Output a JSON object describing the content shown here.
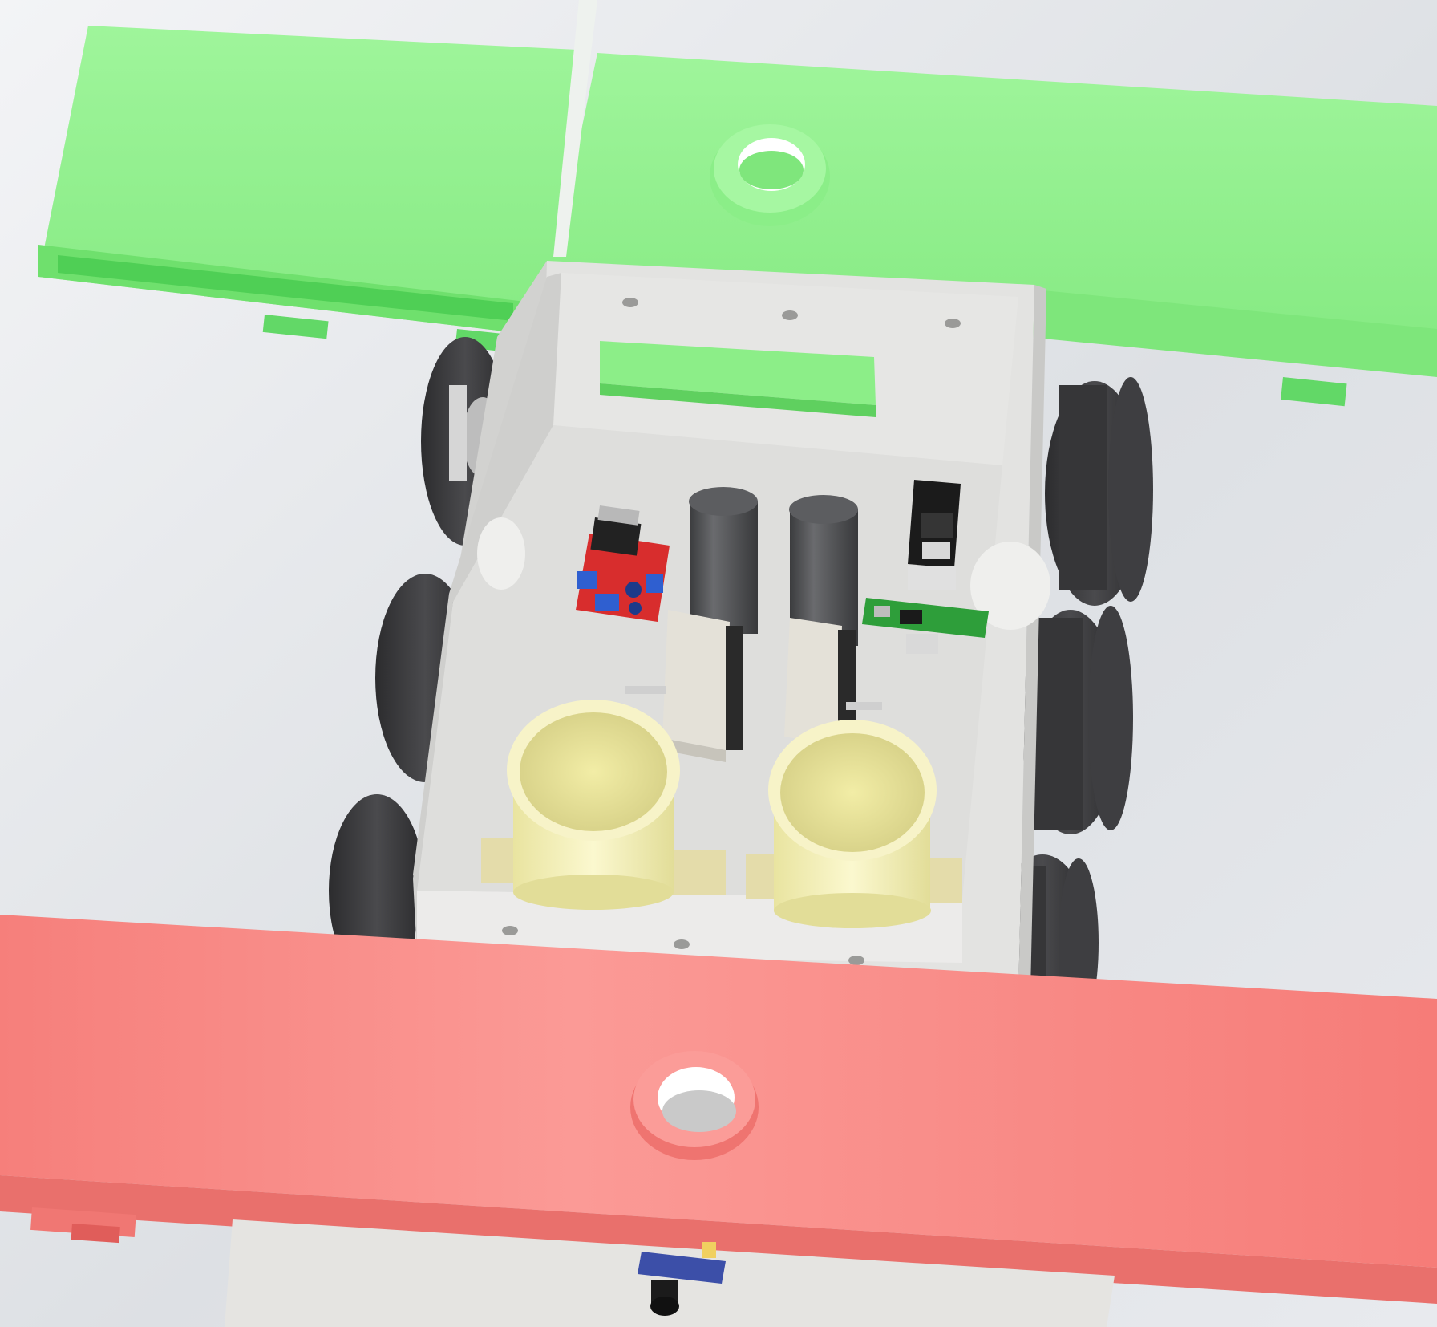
{
  "scene": {
    "background": "#e9ebee",
    "colors": {
      "green_beam": "#93f08f",
      "green_beam_dark": "#62d867",
      "red_beam": "#f78480",
      "red_beam_dark": "#e0625f",
      "chassis": "#e8e8e6",
      "chassis_shadow": "#c8c8c6",
      "wheel": "#3a3a3c",
      "cylinder_dark": "#4b4c4e",
      "tube_yellow": "#f4f0b8",
      "motor_driver_board": "#d82d2d",
      "terminal_block": "#2f5fd0",
      "microcontroller_board": "#1a1a1a",
      "green_pcb": "#2e9e3a",
      "camera_module": "#3c4fa8"
    },
    "components": [
      {
        "name": "green-front-beam",
        "icon": "green-beam-icon"
      },
      {
        "name": "red-rear-beam",
        "icon": "red-beam-icon"
      },
      {
        "name": "chassis-box",
        "icon": "box-icon"
      },
      {
        "name": "wheels",
        "count": 6
      },
      {
        "name": "motor-driver-board",
        "icon": "pcb-red-icon"
      },
      {
        "name": "dc-motors",
        "count": 2
      },
      {
        "name": "microcontroller-board",
        "icon": "pcb-black-icon"
      },
      {
        "name": "green-pcb",
        "icon": "pcb-green-icon"
      },
      {
        "name": "storage-tubes",
        "count": 2
      },
      {
        "name": "camera-module",
        "icon": "camera-icon"
      }
    ]
  }
}
